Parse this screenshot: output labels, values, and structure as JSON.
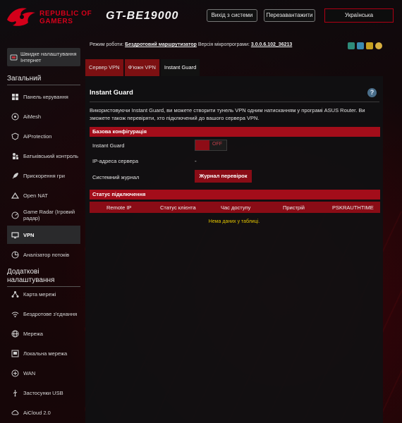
{
  "header": {
    "brand_line1": "REPUBLIC OF",
    "brand_line2": "GAMERS",
    "model": "GT-BE19000",
    "logout_label": "Вихід з системи",
    "reboot_label": "Перезавантажити",
    "language": "Українська"
  },
  "sidebar": {
    "quick_setup": "Швидке налаштування Інтернет",
    "general_title": "Загальний",
    "general_items": [
      {
        "label": "Панель керування",
        "icon": "dashboard-icon"
      },
      {
        "label": "AiMesh",
        "icon": "mesh-icon"
      },
      {
        "label": "AiProtection",
        "icon": "shield-icon"
      },
      {
        "label": "Батьківський контроль",
        "icon": "parental-icon"
      },
      {
        "label": "Прискорення гри",
        "icon": "rocket-icon"
      },
      {
        "label": "Open NAT",
        "icon": "nat-icon"
      },
      {
        "label": "Game Radar (Ігровий радар)",
        "icon": "radar-icon"
      },
      {
        "label": "VPN",
        "icon": "vpn-icon"
      },
      {
        "label": "Аналізатор потоків",
        "icon": "traffic-icon"
      }
    ],
    "advanced_title": "Додаткові налаштування",
    "advanced_items": [
      {
        "label": "Карта мережі",
        "icon": "network-map-icon"
      },
      {
        "label": "Бездротове з'єднання",
        "icon": "wireless-icon"
      },
      {
        "label": "Мережа",
        "icon": "globe-icon"
      },
      {
        "label": "Локальна мережа",
        "icon": "lan-icon"
      },
      {
        "label": "WAN",
        "icon": "wan-icon"
      },
      {
        "label": "Застосунки USB",
        "icon": "usb-icon"
      },
      {
        "label": "AiCloud 2.0",
        "icon": "cloud-icon"
      }
    ]
  },
  "status": {
    "mode_label": "Режим роботи:",
    "mode_value": "Бездротовий маршрутизатор",
    "fw_label": "Версія мікропрограми:",
    "fw_value": "3.0.0.6.102_36213"
  },
  "tabs": [
    "Сервер VPN",
    "Ф'южн VPN",
    "Instant Guard"
  ],
  "page": {
    "title": "Instant Guard",
    "description": "Використовуючи Instant Guard, ви можете створити тунель VPN одним натисканням у програмі ASUS Router. Ви зможете також перевіряти, хто підключений до вашого сервера VPN.",
    "basic_config_title": "Базова конфігурація",
    "instant_guard_label": "Instant Guard",
    "toggle_state": "OFF",
    "server_ip_label": "IP-адреса сервера",
    "server_ip_value": "-",
    "syslog_label": "Системний журнал",
    "syslog_button": "Журнал перевірок",
    "connection_status_title": "Статус підключення",
    "columns": [
      "Remote IP",
      "Статус клієнта",
      "Час доступу",
      "Пристрій",
      "PSKRAUTHTIME"
    ],
    "empty_message": "Нема даних у таблиці."
  },
  "colors": {
    "accent": "#a30d1a",
    "brand_red": "#d4001a",
    "empty_text": "#e0c200"
  }
}
